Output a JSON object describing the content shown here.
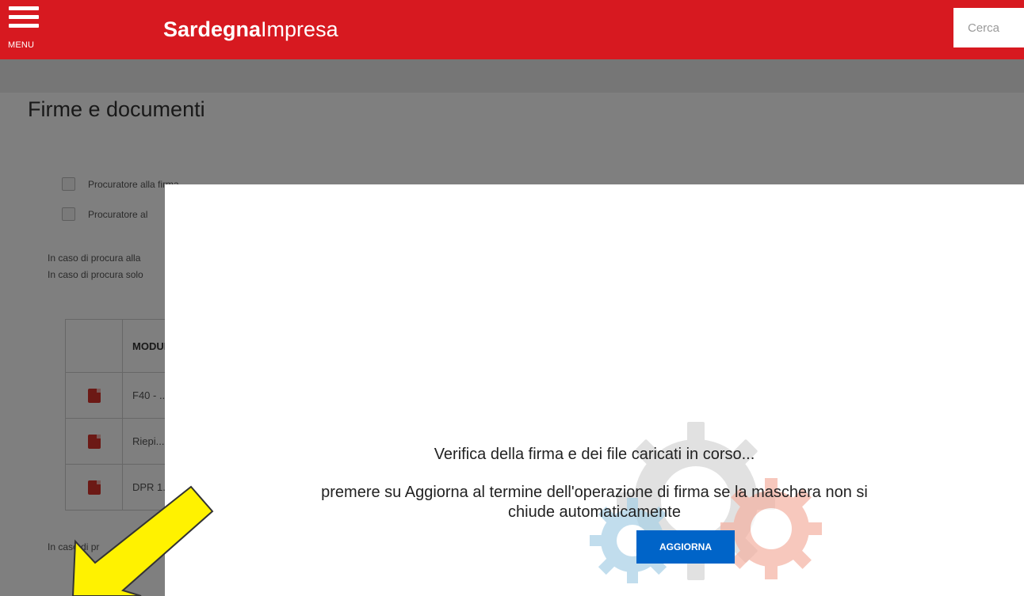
{
  "header": {
    "menu_label": "MENU",
    "brand_bold": "Sardegna",
    "brand_light": "Impresa",
    "search_placeholder": "Cerca"
  },
  "page": {
    "title": "Firme e documenti",
    "checkboxes": [
      {
        "label": "Procuratore alla firma"
      },
      {
        "label": "Procuratore al"
      }
    ],
    "notes": [
      "In caso di procura alla",
      "In caso di procura solo",
      "In caso di pr"
    ],
    "table": {
      "header": "MODULO",
      "rows": [
        {
          "text": "F40 - ..."
        },
        {
          "text": "Riepi..."
        },
        {
          "text": "DPR 1..."
        }
      ]
    }
  },
  "modal": {
    "message_main": "Verifica della firma e dei file caricati in corso...",
    "message_hint": "premere su Aggiorna al termine dell'operazione di firma se la maschera non si chiude automaticamente",
    "button_label": "AGGIORNA"
  },
  "colors": {
    "header_red": "#d71920",
    "button_blue": "#0064c8",
    "arrow_yellow": "#fff200",
    "gear_blue": "#9cc8e0",
    "gear_grey": "#c9c9c9",
    "gear_red": "#f0a08c"
  },
  "icons": [
    "menu-icon",
    "pdf-icon",
    "gears-icon",
    "arrow-annotation"
  ]
}
